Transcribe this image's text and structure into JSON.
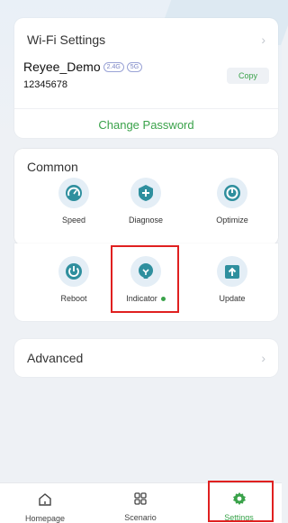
{
  "wifi": {
    "title": "Wi-Fi Settings",
    "ssid": "Reyee_Demo",
    "band_24": "2.4G",
    "band_5": "5G",
    "password": "12345678",
    "copy_label": "Copy",
    "change_password_label": "Change Password"
  },
  "common": {
    "title": "Common",
    "items": [
      {
        "label": "Speed",
        "icon": "speedometer-icon"
      },
      {
        "label": "Diagnose",
        "icon": "diagnose-plus-icon"
      },
      {
        "label": "Optimize",
        "icon": "optimize-icon"
      },
      {
        "label": "Reboot",
        "icon": "power-icon"
      },
      {
        "label": "Indicator",
        "icon": "indicator-light-icon"
      },
      {
        "label": "Update",
        "icon": "update-arrow-icon"
      }
    ]
  },
  "advanced": {
    "title": "Advanced"
  },
  "tabbar": {
    "items": [
      {
        "label": "Homepage",
        "icon": "home-icon"
      },
      {
        "label": "Scenario",
        "icon": "grid-icon"
      },
      {
        "label": "Settings",
        "icon": "gear-icon",
        "active": true
      }
    ]
  },
  "colors": {
    "accent": "#3aa24a",
    "icon_teal": "#2f8f9e",
    "highlight": "#e02020"
  }
}
